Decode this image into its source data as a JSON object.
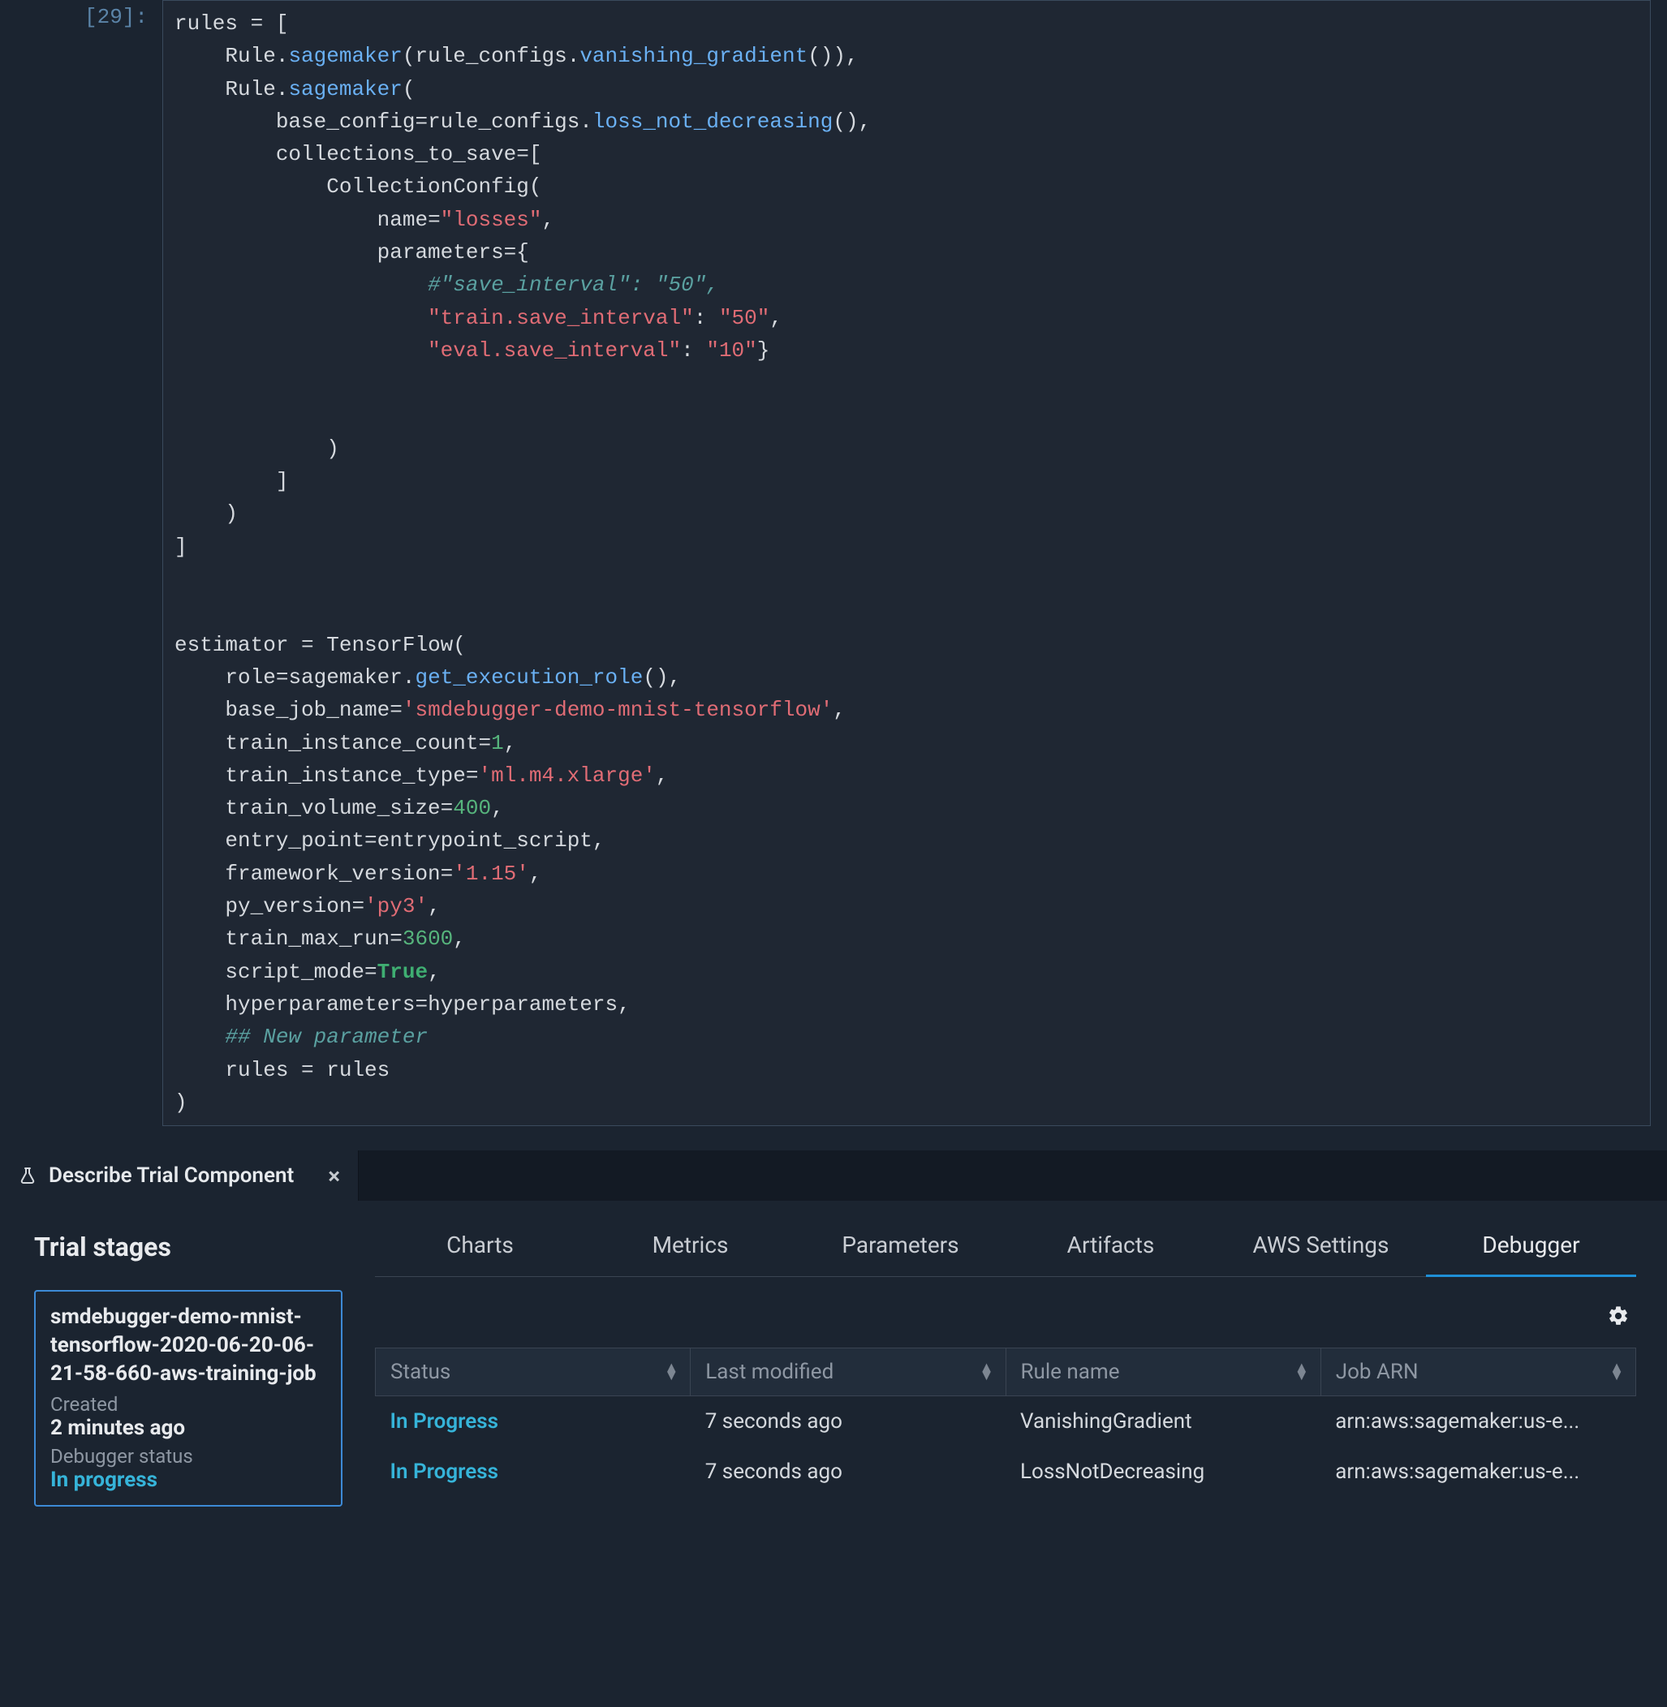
{
  "code": {
    "prompt": "[29]:",
    "tokens": [
      [
        [
          "rules ",
          "name"
        ],
        [
          "= ",
          "op"
        ],
        [
          "[",
          "op"
        ]
      ],
      [
        [
          "    Rule",
          "name"
        ],
        [
          ".",
          "op"
        ],
        [
          "sagemaker",
          "func"
        ],
        [
          "(rule_configs",
          "name"
        ],
        [
          ".",
          "op"
        ],
        [
          "vanishing_gradient",
          "func"
        ],
        [
          "()),",
          "op"
        ]
      ],
      [
        [
          "    Rule",
          "name"
        ],
        [
          ".",
          "op"
        ],
        [
          "sagemaker",
          "func"
        ],
        [
          "(",
          "op"
        ]
      ],
      [
        [
          "        base_config",
          "name"
        ],
        [
          "=",
          "op"
        ],
        [
          "rule_configs",
          "name"
        ],
        [
          ".",
          "op"
        ],
        [
          "loss_not_decreasing",
          "func"
        ],
        [
          "(),",
          "op"
        ]
      ],
      [
        [
          "        collections_to_save",
          "name"
        ],
        [
          "=",
          "op"
        ],
        [
          "[",
          "op"
        ]
      ],
      [
        [
          "            CollectionConfig(",
          "name"
        ]
      ],
      [
        [
          "                name",
          "name"
        ],
        [
          "=",
          "op"
        ],
        [
          "\"losses\"",
          "string"
        ],
        [
          ",",
          "op"
        ]
      ],
      [
        [
          "                parameters",
          "name"
        ],
        [
          "=",
          "op"
        ],
        [
          "{",
          "op"
        ]
      ],
      [
        [
          "                    ",
          "name"
        ],
        [
          "#\"save_interval\": \"50\",",
          "comment"
        ]
      ],
      [
        [
          "                    ",
          "name"
        ],
        [
          "\"train.save_interval\"",
          "string"
        ],
        [
          ": ",
          "op"
        ],
        [
          "\"50\"",
          "string"
        ],
        [
          ",",
          "op"
        ]
      ],
      [
        [
          "                    ",
          "name"
        ],
        [
          "\"eval.save_interval\"",
          "string"
        ],
        [
          ": ",
          "op"
        ],
        [
          "\"10\"",
          "string"
        ],
        [
          "}",
          "op"
        ]
      ],
      [
        [
          "",
          "name"
        ]
      ],
      [
        [
          "",
          "name"
        ]
      ],
      [
        [
          "            )",
          "op"
        ]
      ],
      [
        [
          "        ]",
          "op"
        ]
      ],
      [
        [
          "    )",
          "op"
        ]
      ],
      [
        [
          "]",
          "op"
        ]
      ],
      [
        [
          "",
          "name"
        ]
      ],
      [
        [
          "",
          "name"
        ]
      ],
      [
        [
          "estimator ",
          "name"
        ],
        [
          "= ",
          "op"
        ],
        [
          "TensorFlow(",
          "name"
        ]
      ],
      [
        [
          "    role",
          "name"
        ],
        [
          "=",
          "op"
        ],
        [
          "sagemaker",
          "name"
        ],
        [
          ".",
          "op"
        ],
        [
          "get_execution_role",
          "func"
        ],
        [
          "(),",
          "op"
        ]
      ],
      [
        [
          "    base_job_name",
          "name"
        ],
        [
          "=",
          "op"
        ],
        [
          "'smdebugger-demo-mnist-tensorflow'",
          "string"
        ],
        [
          ",",
          "op"
        ]
      ],
      [
        [
          "    train_instance_count",
          "name"
        ],
        [
          "=",
          "op"
        ],
        [
          "1",
          "num"
        ],
        [
          ",",
          "op"
        ]
      ],
      [
        [
          "    train_instance_type",
          "name"
        ],
        [
          "=",
          "op"
        ],
        [
          "'ml.m4.xlarge'",
          "string"
        ],
        [
          ",",
          "op"
        ]
      ],
      [
        [
          "    train_volume_size",
          "name"
        ],
        [
          "=",
          "op"
        ],
        [
          "400",
          "num"
        ],
        [
          ",",
          "op"
        ]
      ],
      [
        [
          "    entry_point",
          "name"
        ],
        [
          "=",
          "op"
        ],
        [
          "entrypoint_script,",
          "name"
        ]
      ],
      [
        [
          "    framework_version",
          "name"
        ],
        [
          "=",
          "op"
        ],
        [
          "'1.15'",
          "string"
        ],
        [
          ",",
          "op"
        ]
      ],
      [
        [
          "    py_version",
          "name"
        ],
        [
          "=",
          "op"
        ],
        [
          "'py3'",
          "string"
        ],
        [
          ",",
          "op"
        ]
      ],
      [
        [
          "    train_max_run",
          "name"
        ],
        [
          "=",
          "op"
        ],
        [
          "3600",
          "num"
        ],
        [
          ",",
          "op"
        ]
      ],
      [
        [
          "    script_mode",
          "name"
        ],
        [
          "=",
          "op"
        ],
        [
          "True",
          "bool"
        ],
        [
          ",",
          "op"
        ]
      ],
      [
        [
          "    hyperparameters",
          "name"
        ],
        [
          "=",
          "op"
        ],
        [
          "hyperparameters,",
          "name"
        ]
      ],
      [
        [
          "    ",
          "name"
        ],
        [
          "## New parameter",
          "comment"
        ]
      ],
      [
        [
          "    rules ",
          "name"
        ],
        [
          "= ",
          "op"
        ],
        [
          "rules",
          "name"
        ]
      ],
      [
        [
          ")",
          "op"
        ]
      ]
    ]
  },
  "panel": {
    "tab_title": "Describe Trial Component"
  },
  "stages_heading": "Trial stages",
  "stage": {
    "title": "smdebugger-demo-mnist-tensorflow-2020-06-20-06-21-58-660-aws-training-job",
    "created_label": "Created",
    "created_value": "2 minutes ago",
    "dbg_label": "Debugger status",
    "dbg_value": "In progress"
  },
  "detail_tabs": [
    "Charts",
    "Metrics",
    "Parameters",
    "Artifacts",
    "AWS Settings",
    "Debugger"
  ],
  "detail_active": 5,
  "columns": {
    "status": "Status",
    "modified": "Last modified",
    "rule": "Rule name",
    "arn": "Job ARN"
  },
  "rows": [
    {
      "status": "In Progress",
      "modified": "7 seconds ago",
      "rule": "VanishingGradient",
      "arn": "arn:aws:sagemaker:us-e..."
    },
    {
      "status": "In Progress",
      "modified": "7 seconds ago",
      "rule": "LossNotDecreasing",
      "arn": "arn:aws:sagemaker:us-e..."
    }
  ]
}
